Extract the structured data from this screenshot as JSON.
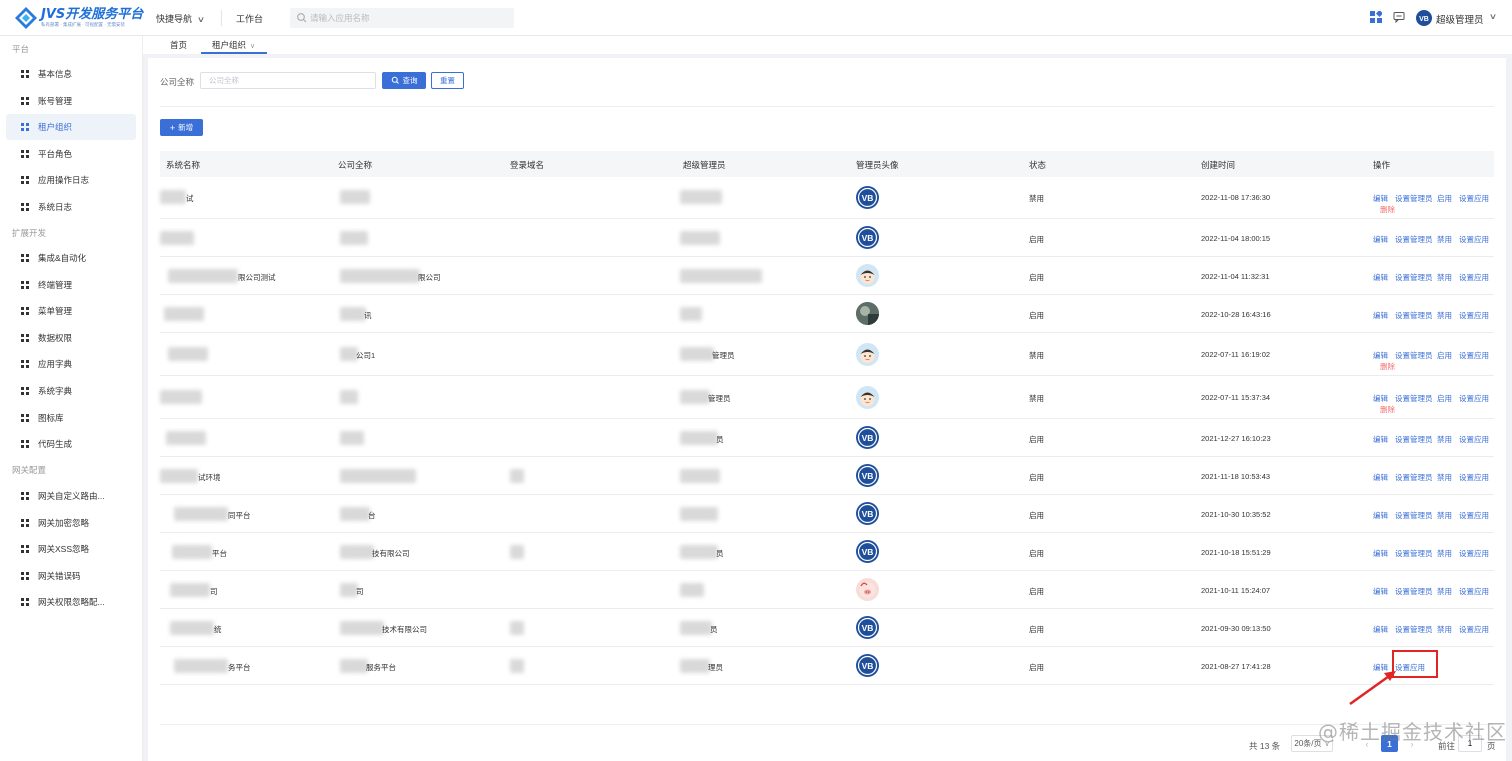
{
  "header": {
    "logo_title": "JVS开发服务平台",
    "logo_subtitle": "私有部署 · 集成扩展 · 可视配置 · 无需安装",
    "quick_nav": "快捷导航",
    "workbench": "工作台",
    "search_placeholder": "请输入应用名称",
    "user_name": "超级管理员",
    "avatar_text": "VB"
  },
  "sidebar": {
    "groups": [
      {
        "title": "平台",
        "items": [
          {
            "label": "基本信息",
            "active": false
          },
          {
            "label": "账号管理",
            "active": false
          },
          {
            "label": "租户组织",
            "active": true
          },
          {
            "label": "平台角色",
            "active": false
          },
          {
            "label": "应用操作日志",
            "active": false
          },
          {
            "label": "系统日志",
            "active": false
          }
        ]
      },
      {
        "title": "扩展开发",
        "items": [
          {
            "label": "集成&自动化",
            "active": false
          },
          {
            "label": "终端管理",
            "active": false
          },
          {
            "label": "菜单管理",
            "active": false
          },
          {
            "label": "数据权限",
            "active": false
          },
          {
            "label": "应用字典",
            "active": false
          },
          {
            "label": "系统字典",
            "active": false
          },
          {
            "label": "图标库",
            "active": false
          },
          {
            "label": "代码生成",
            "active": false
          }
        ]
      },
      {
        "title": "网关配置",
        "items": [
          {
            "label": "网关自定义路由...",
            "active": false
          },
          {
            "label": "网关加密忽略",
            "active": false
          },
          {
            "label": "网关XSS忽略",
            "active": false
          },
          {
            "label": "网关错误码",
            "active": false
          },
          {
            "label": "网关权限忽略配...",
            "active": false
          }
        ]
      }
    ]
  },
  "tabs": [
    {
      "label": "首页",
      "active": false
    },
    {
      "label": "租户组织",
      "active": true
    }
  ],
  "filter": {
    "label": "公司全称",
    "placeholder": "公司全称",
    "query_button": "查询",
    "reset_button": "重置"
  },
  "add_button": "新增",
  "table": {
    "columns": [
      "系统名称",
      "公司全称",
      "登录域名",
      "超级管理员",
      "管理员头像",
      "状态",
      "创建时间",
      "操作"
    ],
    "rows": [
      {
        "system_name": "试",
        "company": "",
        "domain": "",
        "admin": "",
        "avatar": "vb",
        "status": "禁用",
        "created": "2022-11-08 17:36:30",
        "actions": [
          "编辑",
          "设置管理员",
          "启用",
          "设置应用"
        ],
        "delete": "删除"
      },
      {
        "system_name": "",
        "company": "",
        "domain": "",
        "admin": "",
        "avatar": "vb",
        "status": "启用",
        "created": "2022-11-04 18:00:15",
        "actions": [
          "编辑",
          "设置管理员",
          "禁用",
          "设置应用"
        ],
        "delete": ""
      },
      {
        "system_name": "限公司测试",
        "company": "限公司",
        "domain": "",
        "admin": "",
        "avatar": "boy",
        "status": "启用",
        "created": "2022-11-04 11:32:31",
        "actions": [
          "编辑",
          "设置管理员",
          "禁用",
          "设置应用"
        ],
        "delete": ""
      },
      {
        "system_name": "",
        "company": "讯",
        "domain": "",
        "admin": "",
        "avatar": "photo",
        "status": "启用",
        "created": "2022-10-28 16:43:16",
        "actions": [
          "编辑",
          "设置管理员",
          "禁用",
          "设置应用"
        ],
        "delete": ""
      },
      {
        "system_name": "",
        "company": "公司1",
        "domain": "",
        "admin": "管理员",
        "avatar": "boy",
        "status": "禁用",
        "created": "2022-07-11 16:19:02",
        "actions": [
          "编辑",
          "设置管理员",
          "启用",
          "设置应用"
        ],
        "delete": "删除"
      },
      {
        "system_name": "",
        "company": "",
        "domain": "",
        "admin": "管理员",
        "avatar": "boy",
        "status": "禁用",
        "created": "2022-07-11 15:37:34",
        "actions": [
          "编辑",
          "设置管理员",
          "启用",
          "设置应用"
        ],
        "delete": "删除"
      },
      {
        "system_name": "",
        "company": "",
        "domain": "",
        "admin": "员",
        "avatar": "vb",
        "status": "启用",
        "created": "2021-12-27 16:10:23",
        "actions": [
          "编辑",
          "设置管理员",
          "禁用",
          "设置应用"
        ],
        "delete": ""
      },
      {
        "system_name": "试环境",
        "company": "",
        "domain": "",
        "admin": "",
        "avatar": "vb",
        "status": "启用",
        "created": "2021-11-18 10:53:43",
        "actions": [
          "编辑",
          "设置管理员",
          "禁用",
          "设置应用"
        ],
        "delete": ""
      },
      {
        "system_name": "同平台",
        "company": "台",
        "domain": "",
        "admin": "",
        "avatar": "vb",
        "status": "启用",
        "created": "2021-10-30 10:35:52",
        "actions": [
          "编辑",
          "设置管理员",
          "禁用",
          "设置应用"
        ],
        "delete": ""
      },
      {
        "system_name": "平台",
        "company": "技有限公司",
        "domain": "",
        "admin": "员",
        "avatar": "vb",
        "status": "启用",
        "created": "2021-10-18 15:51:29",
        "actions": [
          "编辑",
          "设置管理员",
          "禁用",
          "设置应用"
        ],
        "delete": ""
      },
      {
        "system_name": "司",
        "company": "司",
        "domain": "",
        "admin": "",
        "avatar": "pig",
        "status": "启用",
        "created": "2021-10-11 15:24:07",
        "actions": [
          "编辑",
          "设置管理员",
          "禁用",
          "设置应用"
        ],
        "delete": ""
      },
      {
        "system_name": "统",
        "company": "技术有限公司",
        "domain": "",
        "admin": "员",
        "avatar": "vb",
        "status": "启用",
        "created": "2021-09-30 09:13:50",
        "actions": [
          "编辑",
          "设置管理员",
          "禁用",
          "设置应用"
        ],
        "delete": ""
      },
      {
        "system_name": "务平台",
        "company": "服务平台",
        "domain": "",
        "admin": "理员",
        "avatar": "vb",
        "status": "启用",
        "created": "2021-08-27 17:41:28",
        "actions": [
          "编辑",
          "设置应用"
        ],
        "delete": ""
      }
    ]
  },
  "pagination": {
    "total": "共 13 条",
    "page_size": "20条/页",
    "current_page": "1",
    "goto_label": "前往",
    "goto_value": "1",
    "unit": "页"
  },
  "watermark": "@稀土掘金技术社区",
  "colors": {
    "primary": "#3a6fd8",
    "danger": "#f56c6c",
    "annotation": "#e12424"
  }
}
